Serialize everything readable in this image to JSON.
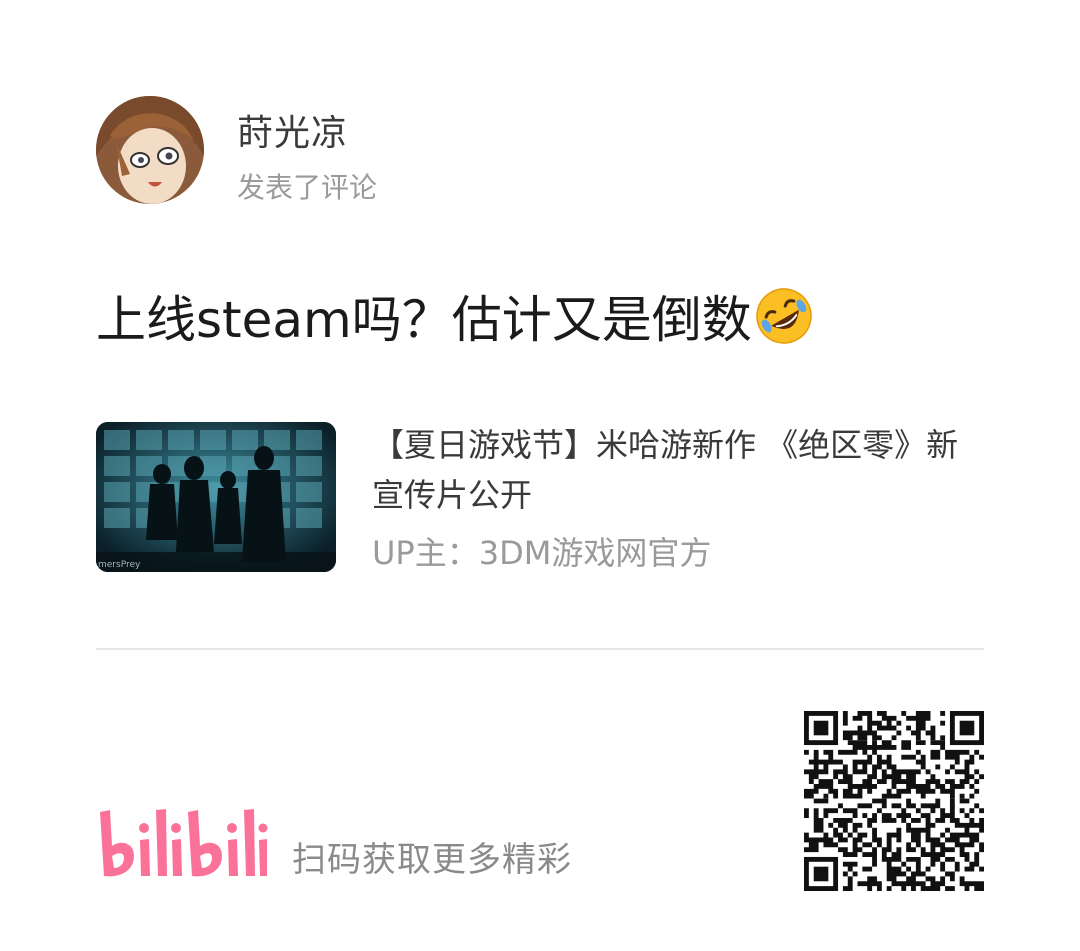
{
  "user": {
    "name": "莳光凉",
    "action": "发表了评论"
  },
  "comment": {
    "text": "上线steam吗？估计又是倒数",
    "emoji": "rolling-on-floor-laughing-emoji"
  },
  "video": {
    "title": "【夏日游戏节】米哈游新作 《绝区零》新宣传片公开",
    "uploader": "UP主：3DM游戏网官方",
    "thumb_watermark": "mersPrey"
  },
  "footer": {
    "logo_text": "bilibili",
    "scan_text": "扫码获取更多精彩"
  },
  "colors": {
    "brand_pink": "#fb7299",
    "text_primary": "#1b1b1b",
    "text_secondary": "#9a9a9a",
    "divider": "#e6e6e6"
  }
}
